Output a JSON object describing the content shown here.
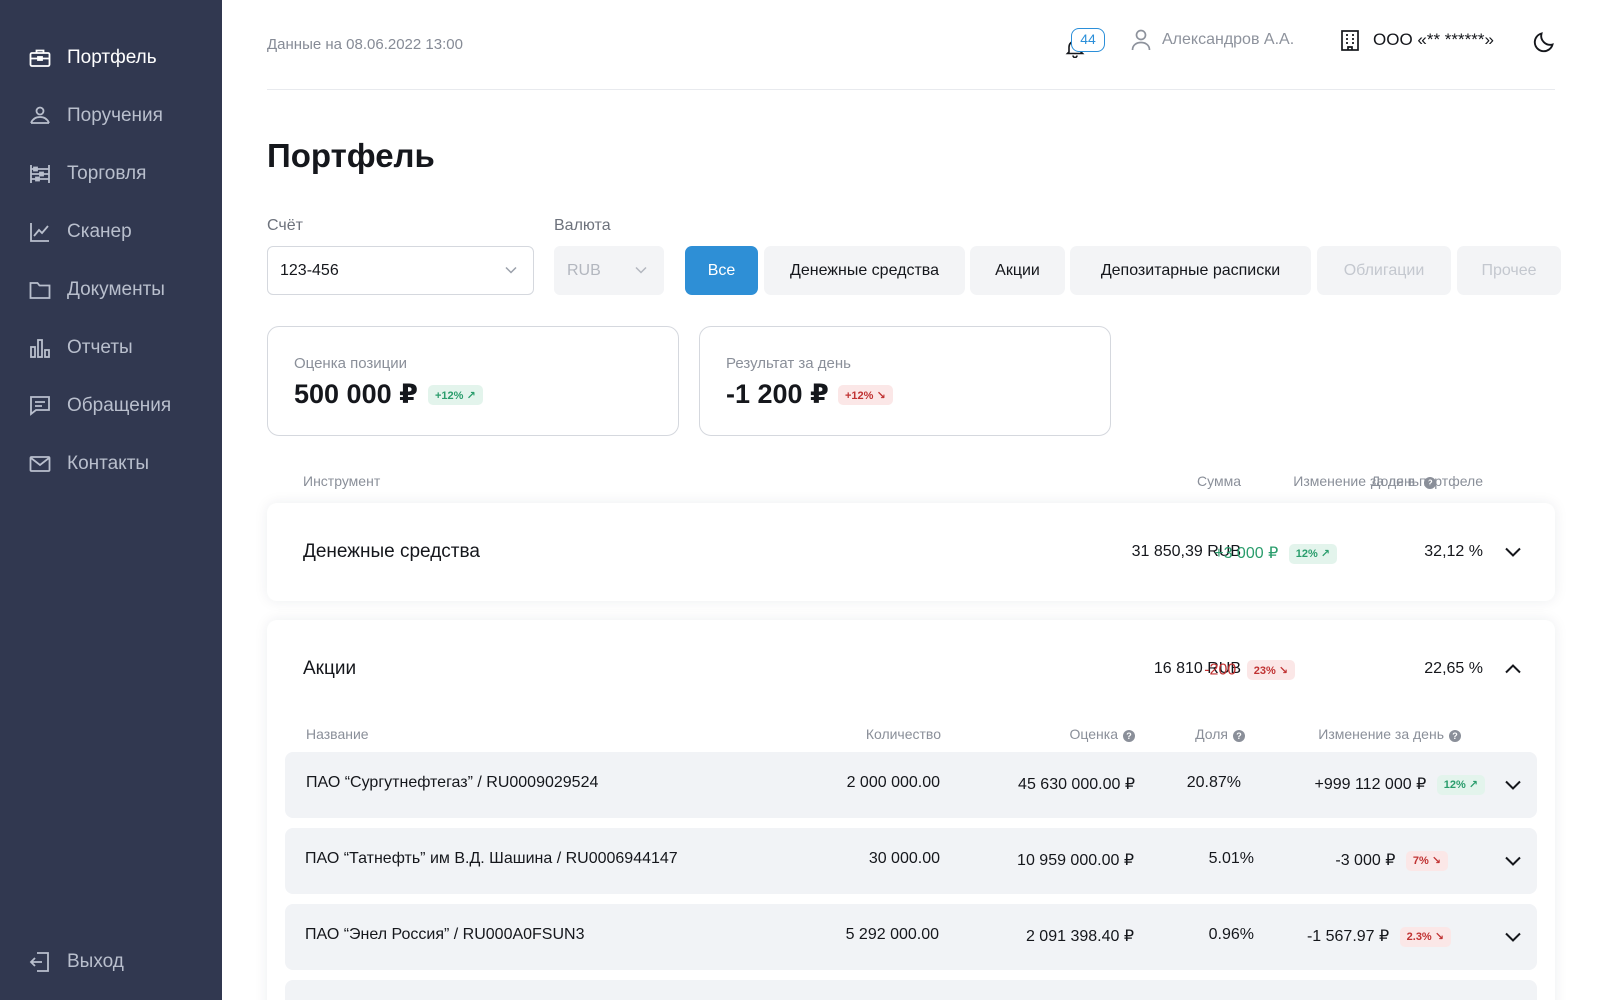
{
  "sidebar": {
    "items": [
      {
        "label": "Портфель",
        "icon": "briefcase-icon",
        "active": true
      },
      {
        "label": "Поручения",
        "icon": "hand-coin-icon"
      },
      {
        "label": "Торговля",
        "icon": "abacus-icon"
      },
      {
        "label": "Сканер",
        "icon": "line-chart-icon"
      },
      {
        "label": "Документы",
        "icon": "folder-icon"
      },
      {
        "label": "Отчеты",
        "icon": "bar-chart-icon"
      },
      {
        "label": "Обращения",
        "icon": "chat-icon"
      },
      {
        "label": "Контакты",
        "icon": "mail-icon"
      }
    ],
    "logout": {
      "label": "Выход",
      "icon": "logout-icon"
    }
  },
  "header": {
    "data_date": "Данные на 08.06.2022 13:00",
    "notifications_count": "44",
    "user_name": "Александров А.А.",
    "org_name": "ООО «** ******»"
  },
  "page": {
    "title": "Портфель"
  },
  "filters": {
    "account_label": "Счёт",
    "account_value": "123-456",
    "currency_label": "Валюта",
    "currency_value": "RUB",
    "chips": [
      "Все",
      "Денежные средства",
      "Акции",
      "Депозитарные расписки",
      "Облигации",
      "Прочее"
    ]
  },
  "summary": {
    "position": {
      "label": "Оценка позиции",
      "value": "500 000 ₽",
      "badge": "+12% ↗"
    },
    "day_result": {
      "label": "Результат за день",
      "value": "-1 200 ₽",
      "badge": "+12% ↘"
    }
  },
  "table": {
    "headers": {
      "instrument": "Инструмент",
      "sum": "Сумма",
      "change": "Изменение за день",
      "share": "Доля в портфеле"
    },
    "groups": [
      {
        "name": "Денежные средства",
        "sum": "31 850,39 RUB",
        "change": "+3 000 ₽",
        "change_pct": "12% ↗",
        "share": "32,12 %"
      },
      {
        "name": "Акции",
        "sum": "16 810 RUB",
        "change": "-200",
        "change_pct": "23% ↘",
        "share": "22,65 %"
      }
    ],
    "sub_headers": {
      "name": "Название",
      "qty": "Количество",
      "value": "Оценка",
      "share": "Доля",
      "change": "Изменение за день"
    },
    "rows": [
      {
        "name": "ПАО “Сургутнефтегаз” / RU0009029524",
        "qty": "2 000 000.00",
        "value": "45 630 000.00 ₽",
        "share": "20.87%",
        "change": "+999 112 000 ₽",
        "change_pct": "12% ↗"
      },
      {
        "name": "ПАО “Татнефть” им В.Д. Шашина / RU0006944147",
        "qty": "30 000.00",
        "value": "10 959 000.00 ₽",
        "share": "5.01%",
        "change": "-3 000 ₽",
        "change_pct": "7% ↘"
      },
      {
        "name": "ПАО “Энел Россия” / RU000A0FSUN3",
        "qty": "5 292 000.00",
        "value": "2 091 398.40 ₽",
        "share": "0.96%",
        "change": "-1 567.97 ₽",
        "change_pct": "2.3% ↘"
      }
    ]
  },
  "colors": {
    "sidebar_bg": "#313850",
    "accent": "#2e8fd6",
    "positive": "#2a9d6c",
    "negative": "#c03232"
  }
}
